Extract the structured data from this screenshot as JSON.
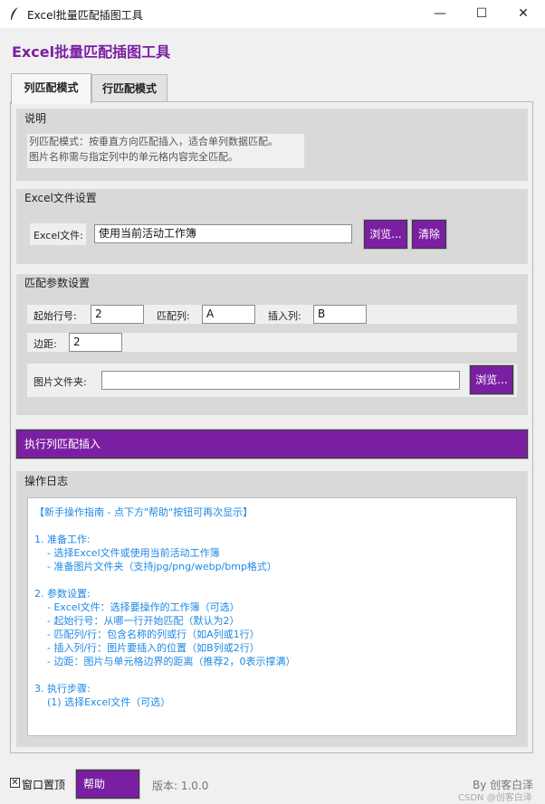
{
  "window": {
    "title": "Excel批量匹配插图工具",
    "feather_icon": "feather-icon",
    "controls": {
      "minimize": "—",
      "maximize": "☐",
      "close": "✕"
    }
  },
  "header": {
    "title": "Excel批量匹配插图工具"
  },
  "tabs": [
    {
      "label": "列匹配模式",
      "active": true
    },
    {
      "label": "行匹配模式",
      "active": false
    }
  ],
  "description": {
    "title": "说明",
    "lines": [
      "列匹配模式：按垂直方向匹配插入，适合单列数据匹配。",
      "图片名称需与指定列中的单元格内容完全匹配。"
    ]
  },
  "excel_settings": {
    "title": "Excel文件设置",
    "file_label": "Excel文件:",
    "file_value": "使用当前活动工作簿",
    "browse_label": "浏览...",
    "clear_label": "清除"
  },
  "match_params": {
    "title": "匹配参数设置",
    "start_row_label": "起始行号:",
    "start_row_value": "2",
    "match_col_label": "匹配列:",
    "match_col_value": "A",
    "insert_col_label": "插入列:",
    "insert_col_value": "B",
    "margin_label": "边距:",
    "margin_value": "2",
    "folder_label": "图片文件夹:",
    "folder_value": "",
    "browse_label": "浏览..."
  },
  "execute": {
    "label": "执行列匹配插入"
  },
  "log": {
    "title": "操作日志",
    "lines": [
      "【新手操作指南 - 点下方\"帮助\"按钮可再次显示】",
      "",
      "1. 准备工作:",
      "    - 选择Excel文件或使用当前活动工作簿",
      "    - 准备图片文件夹（支持jpg/png/webp/bmp格式）",
      "",
      "2. 参数设置:",
      "    - Excel文件：选择要操作的工作簿（可选）",
      "    - 起始行号：从哪一行开始匹配（默认为2）",
      "    - 匹配列/行：包含名称的列或行（如A列或1行）",
      "    - 插入列/行：图片要插入的位置（如B列或2行）",
      "    - 边距：图片与单元格边界的距离（推荐2，0表示撑满）",
      "",
      "3. 执行步骤:",
      "    (1) 选择Excel文件（可选）"
    ],
    "color": "#1e88e5"
  },
  "footer": {
    "topmost_label": "窗口置顶",
    "topmost_checked": true,
    "help_label": "帮助",
    "version": "版本: 1.0.0",
    "author": "By 创客白泽",
    "watermark": "CSDN @创客白泽"
  },
  "colors": {
    "accent": "#7b1fa2",
    "log_text": "#1e88e5",
    "frame_bg": "#d9d9d9"
  }
}
